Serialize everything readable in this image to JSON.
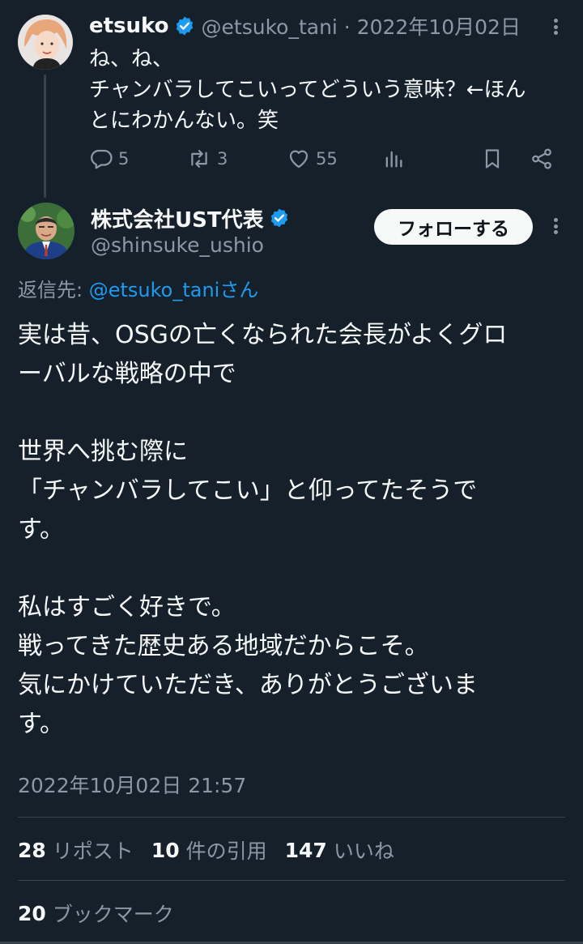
{
  "parent_tweet": {
    "name": "etsuko",
    "handle_time": "@etsuko_tani · 2022年10月02日",
    "text_lines": [
      "ね、ね、",
      "チャンバラしてこいってどういう意味？←ほん",
      "とにわかんない。笑"
    ],
    "stats": {
      "replies": "5",
      "reposts": "3",
      "likes": "55"
    }
  },
  "reply_tweet": {
    "name": "株式会社UST代表",
    "handle": "@shinsuke_ushio",
    "follow_label": "フォローする",
    "reply_to_prefix": "返信先: ",
    "reply_to_mention": "@etsuko_taniさん",
    "body_lines": [
      "実は昔、OSGの亡くなられた会長がよくグロ",
      "ーバルな戦略の中で",
      "",
      "世界へ挑む際に",
      "「チャンバラしてこい」と仰ってたそうで",
      "す。",
      "",
      "私はすごく好きで。",
      "戦ってきた歴史ある地域だからこそ。",
      "気にかけていただき、ありがとうございま",
      "す。"
    ],
    "timestamp": "2022年10月02日 21:57",
    "stats": {
      "reposts_count": "28",
      "reposts_label": "リポスト",
      "quotes_count": "10",
      "quotes_label": "件の引用",
      "likes_count": "147",
      "likes_label": "いいね",
      "bookmarks_count": "20",
      "bookmarks_label": "ブックマーク"
    }
  },
  "colors": {
    "background": "#15202b",
    "text": "#f7f9f9",
    "secondary": "#8b98a5",
    "accent": "#1d9bf0",
    "divider": "#38444d"
  },
  "icons": [
    "verified-badge-icon",
    "reply-icon",
    "repost-icon",
    "like-icon",
    "views-icon",
    "bookmark-icon",
    "share-icon",
    "more-icon"
  ]
}
